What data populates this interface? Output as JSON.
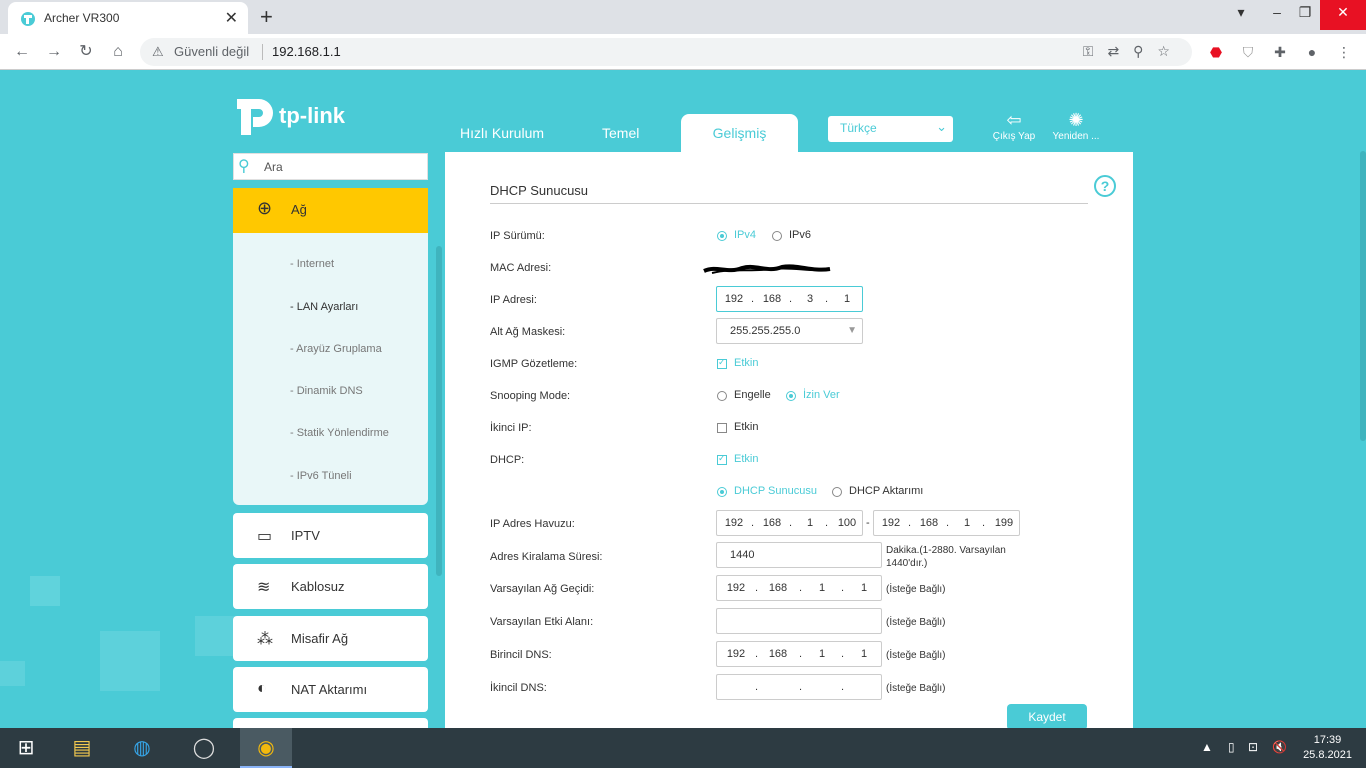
{
  "browser": {
    "tab_title": "Archer VR300",
    "tab_close": "✕",
    "new_tab": "+",
    "security_label": "Güvenli değil",
    "url": "192.168.1.1"
  },
  "header": {
    "logo_text": "tp-link",
    "tabs": [
      "Hızlı Kurulum",
      "Temel",
      "Gelişmiş"
    ],
    "language": "Türkçe",
    "logout_label": "Çıkış Yap",
    "reboot_label": "Yeniden ..."
  },
  "sidebar": {
    "search_placeholder": "Ara",
    "active_section": "Ağ",
    "sub_items": [
      "- Internet",
      "- LAN Ayarları",
      "- Arayüz Gruplama",
      "- Dinamik DNS",
      "- Statik Yönlendirme",
      "- IPv6 Tüneli"
    ],
    "sections": [
      "IPTV",
      "Kablosuz",
      "Misafir Ağ",
      "NAT Aktarımı"
    ]
  },
  "form": {
    "title": "DHCP Sunucusu",
    "labels": {
      "ip_version": "IP Sürümü:",
      "mac": "MAC Adresi:",
      "ip": "IP Adresi:",
      "mask": "Alt Ağ Maskesi:",
      "igmp": "IGMP Gözetleme:",
      "snooping": "Snooping Mode:",
      "second_ip": "İkinci IP:",
      "dhcp": "DHCP:",
      "pool": "IP Adres Havuzu:",
      "lease": "Adres Kiralama Süresi:",
      "gateway": "Varsayılan Ağ Geçidi:",
      "domain": "Varsayılan Etki Alanı:",
      "dns1": "Birincil DNS:",
      "dns2": "İkincil DNS:"
    },
    "ipv4": "IPv4",
    "ipv6": "IPv6",
    "enable": "Etkin",
    "block": "Engelle",
    "allow": "İzin Ver",
    "dhcp_server": "DHCP Sunucusu",
    "dhcp_relay": "DHCP Aktarımı",
    "ip": [
      "192",
      "168",
      "3",
      "1"
    ],
    "mask": "255.255.255.0",
    "pool_start": [
      "192",
      "168",
      "1",
      "100"
    ],
    "pool_end": [
      "192",
      "168",
      "1",
      "199"
    ],
    "pool_dash": "-",
    "lease": "1440",
    "lease_hint": "Dakika.(1-2880. Varsayılan 1440'dır.)",
    "gateway": [
      "192",
      "168",
      "1",
      "1"
    ],
    "dns1": [
      "192",
      "168",
      "1",
      "1"
    ],
    "optional": "(İsteğe Bağlı)",
    "save": "Kaydet"
  },
  "taskbar": {
    "time": "17:39",
    "date": "25.8.2021"
  }
}
